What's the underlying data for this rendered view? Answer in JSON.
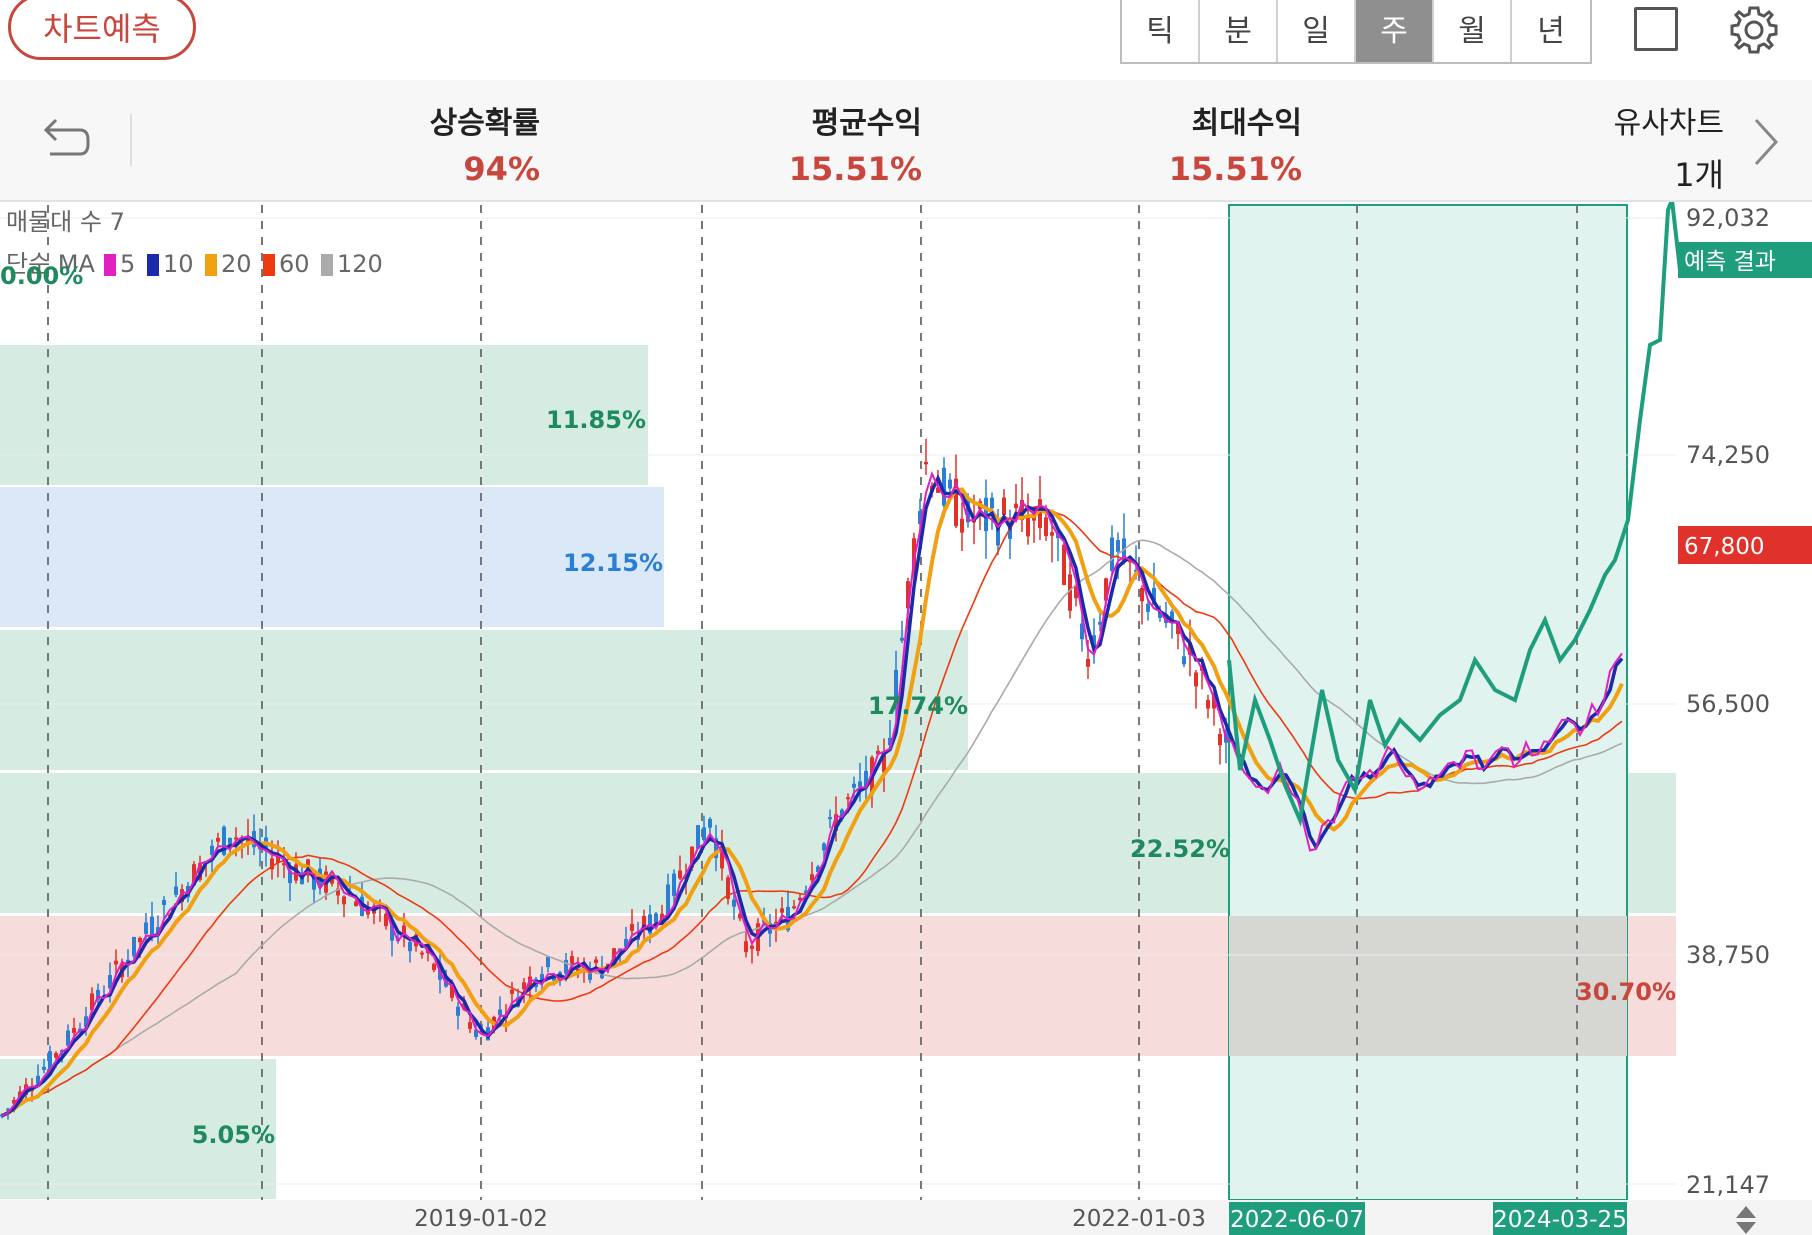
{
  "top": {
    "predict_button": "차트예측",
    "period_tabs": [
      "틱",
      "분",
      "일",
      "주",
      "월",
      "년"
    ],
    "active_tab": "주",
    "icons": [
      "fullscreen-icon",
      "gear-icon"
    ]
  },
  "stats": {
    "back_icon": "undo-icon",
    "items": [
      {
        "label": "상승확률",
        "value": "94%"
      },
      {
        "label": "평균수익",
        "value": "15.51%"
      },
      {
        "label": "최대수익",
        "value": "15.51%"
      }
    ],
    "similar": {
      "label": "유사차트",
      "value": "1개"
    }
  },
  "legend": {
    "line1": "매물대 수 7",
    "ma_label": "단순 MA",
    "ma": [
      {
        "period": "5",
        "color": "#e020c0"
      },
      {
        "period": "10",
        "color": "#1a2aa8"
      },
      {
        "period": "20",
        "color": "#f0a010"
      },
      {
        "period": "60",
        "color": "#ee3a10"
      },
      {
        "period": "120",
        "color": "#aaaaaa"
      }
    ]
  },
  "volume_profile": [
    {
      "label": "0.00%",
      "color": "green"
    },
    {
      "label": "11.85%",
      "color": "green"
    },
    {
      "label": "12.15%",
      "color": "blue"
    },
    {
      "label": "17.74%",
      "color": "green"
    },
    {
      "label": "22.52%",
      "color": "green"
    },
    {
      "label": "30.70%",
      "color": "red"
    },
    {
      "label": "5.05%",
      "color": "green"
    }
  ],
  "y_axis": [
    "92,032",
    "74,250",
    "56,500",
    "38,750",
    "21,147"
  ],
  "current_price": "67,800",
  "prediction_label": "예측 결과",
  "x_axis": [
    "2019-01-02",
    "2022-01-03"
  ],
  "range_tags": [
    "2022-06-07",
    "2024-03-25"
  ],
  "colors": {
    "up": "#e0322a",
    "down": "#2a7fd4",
    "predict": "#1f9e7e",
    "price_tag": "#e0322a",
    "accent_red": "#c9463d"
  }
}
